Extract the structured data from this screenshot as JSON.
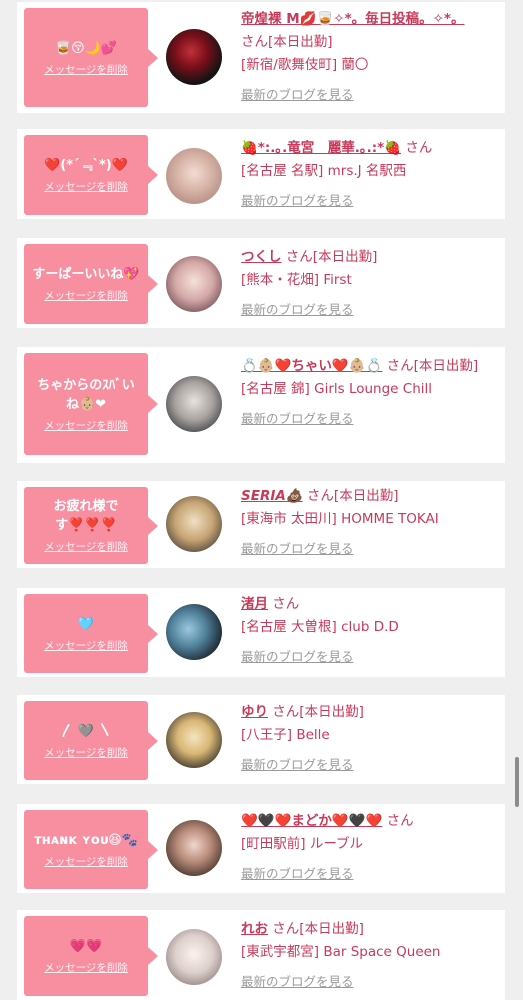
{
  "delete_label": "メッセージを削除",
  "blog_label": "最新のブログを見る",
  "cards": [
    {
      "message": "🥃😚🌙💕",
      "name": "帝煌裸 M💋🥃✧*。毎日投稿。✧*。",
      "suffix": "さん[本日出勤]",
      "shop": "[新宿/歌舞伎町] 蘭〇"
    },
    {
      "message": "❤️(*´﹃`*)❤️",
      "name": "🍓*:.｡.竜宮　麗華.｡.:*🍓",
      "suffix": "さん",
      "shop": "[名古屋 名駅] mrs.J 名駅西"
    },
    {
      "message": "すーぱーいいね💖",
      "name": "つくし",
      "suffix": "さん[本日出勤]",
      "shop": "[熊本・花畑] First"
    },
    {
      "message": "ちゃからのｽﾊﾞいね👶🏼❤",
      "name": "💍👶🏼❤️ちゃい❤️👶🏼💍",
      "suffix": "さん[本日出勤]",
      "shop": "[名古屋 錦] Girls Lounge Chill"
    },
    {
      "message": "お疲れ様です❣️❣️❣️",
      "name": "SERIA💩",
      "suffix": "さん[本日出勤]",
      "shop": "[東海市 太田川] HOMME TOKAI"
    },
    {
      "message": "🩵",
      "name": "渚月",
      "suffix": "さん",
      "shop": "[名古屋 大曽根] club D.D"
    },
    {
      "message": "〳 🩶 〵",
      "name": "ゆり",
      "suffix": "さん[本日出勤]",
      "shop": "[八王子] Belle"
    },
    {
      "message": "ᴛʜᴀɴᴋ ʏᴏᴜ😆🐾",
      "name": "❤️🖤❤️まどか❤️🖤❤️",
      "suffix": "さん",
      "shop": "[町田駅前] ルーブル"
    },
    {
      "message": "💗💗",
      "name": "れお",
      "suffix": "さん[本日出勤]",
      "shop": "[東武宇都宮] Bar Space Queen"
    }
  ]
}
